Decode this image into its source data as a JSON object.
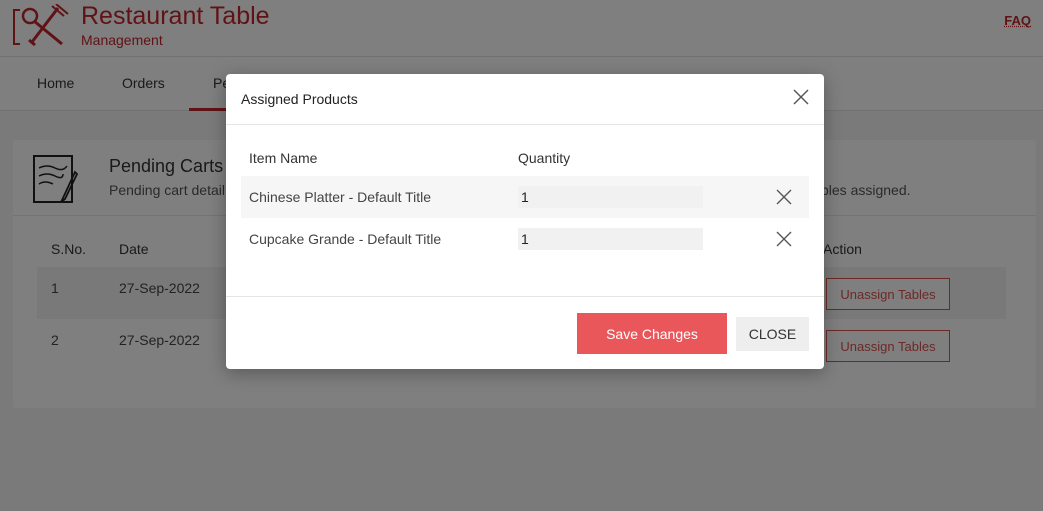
{
  "app": {
    "title": "Restaurant Table",
    "subtitle": "Management",
    "faq_label": "FAQ"
  },
  "nav": {
    "items": [
      {
        "label": "Home"
      },
      {
        "label": "Orders"
      },
      {
        "label": "Pe"
      }
    ]
  },
  "card": {
    "title": "Pending Carts",
    "description": "Pending cart detail",
    "description_tail": "bles assigned.",
    "columns": {
      "sno": "S.No.",
      "date": "Date",
      "action": "Action"
    },
    "rows": [
      {
        "sno": "1",
        "date": "27-Sep-2022",
        "action_label": "Unassign Tables"
      },
      {
        "sno": "2",
        "date": "27-Sep-2022",
        "action_label": "Unassign Tables"
      }
    ]
  },
  "modal": {
    "title": "Assigned Products",
    "columns": {
      "item_name": "Item Name",
      "quantity": "Quantity"
    },
    "items": [
      {
        "name": "Chinese Platter - Default Title",
        "quantity": "1"
      },
      {
        "name": "Cupcake Grande - Default Title",
        "quantity": "1"
      }
    ],
    "save_label": "Save Changes",
    "close_label": "CLOSE"
  },
  "colors": {
    "brand": "#c0272d",
    "save_button": "#e9575b"
  }
}
